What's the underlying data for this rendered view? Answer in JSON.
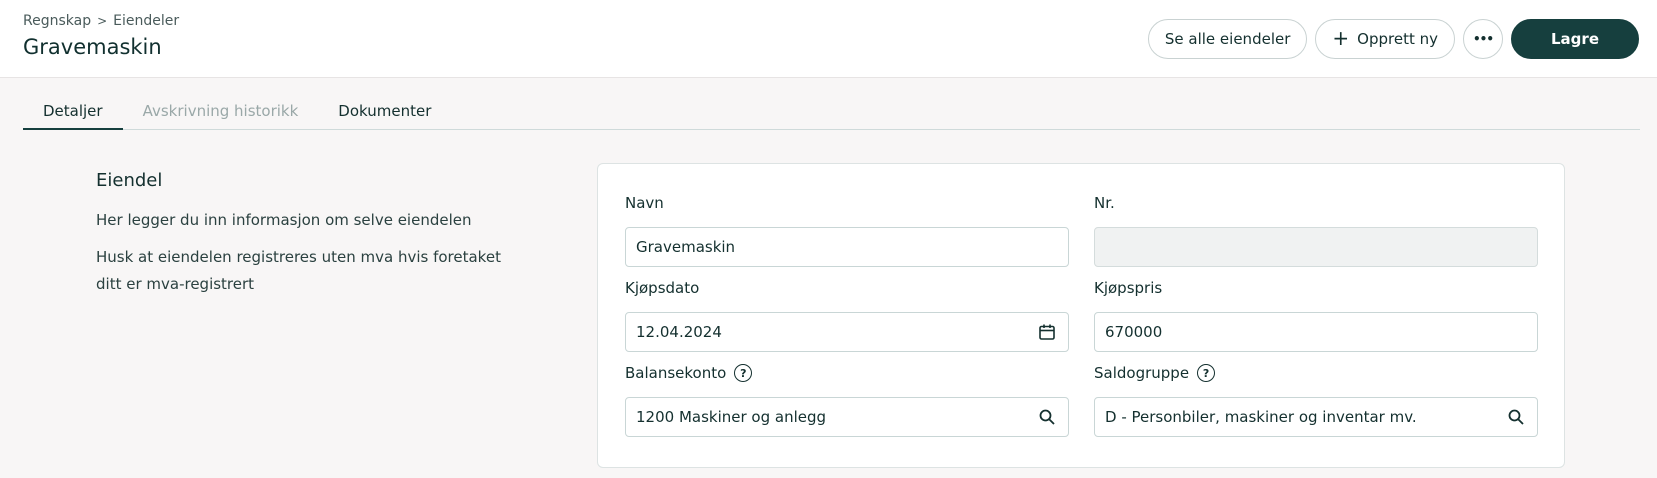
{
  "breadcrumb": {
    "items": [
      "Regnskap",
      "Eiendeler"
    ],
    "separator": ">"
  },
  "header": {
    "title": "Gravemaskin"
  },
  "actions": {
    "see_all_label": "Se alle eiendeler",
    "create_new_label": "Opprett ny",
    "more_label": "•••",
    "save_label": "Lagre"
  },
  "tabs": [
    {
      "label": "Detaljer",
      "state": "active"
    },
    {
      "label": "Avskrivning historikk",
      "state": "disabled"
    },
    {
      "label": "Dokumenter",
      "state": "normal"
    }
  ],
  "section": {
    "title": "Eiendel",
    "text1": "Her legger du inn informasjon om selve eiendelen",
    "text2": "Husk at eiendelen registreres uten mva hvis foretaket ditt er mva-registrert"
  },
  "form": {
    "navn": {
      "label": "Navn",
      "value": "Gravemaskin"
    },
    "nr": {
      "label": "Nr.",
      "value": ""
    },
    "kjopsdato": {
      "label": "Kjøpsdato",
      "value": "12.04.2024"
    },
    "kjopspris": {
      "label": "Kjøpspris",
      "value": "670000"
    },
    "balansekonto": {
      "label": "Balansekonto",
      "value": "1200 Maskiner og anlegg",
      "help": "?"
    },
    "saldogruppe": {
      "label": "Saldogruppe",
      "value": "D - Personbiler, maskiner og inventar mv.",
      "help": "?"
    }
  },
  "icons": {
    "calendar": "calendar-icon",
    "search": "search-icon",
    "help": "help-icon",
    "plus": "plus-icon"
  },
  "colors": {
    "primary": "#163f3e",
    "border": "#c9d6d6",
    "background": "#f8f6f6"
  }
}
